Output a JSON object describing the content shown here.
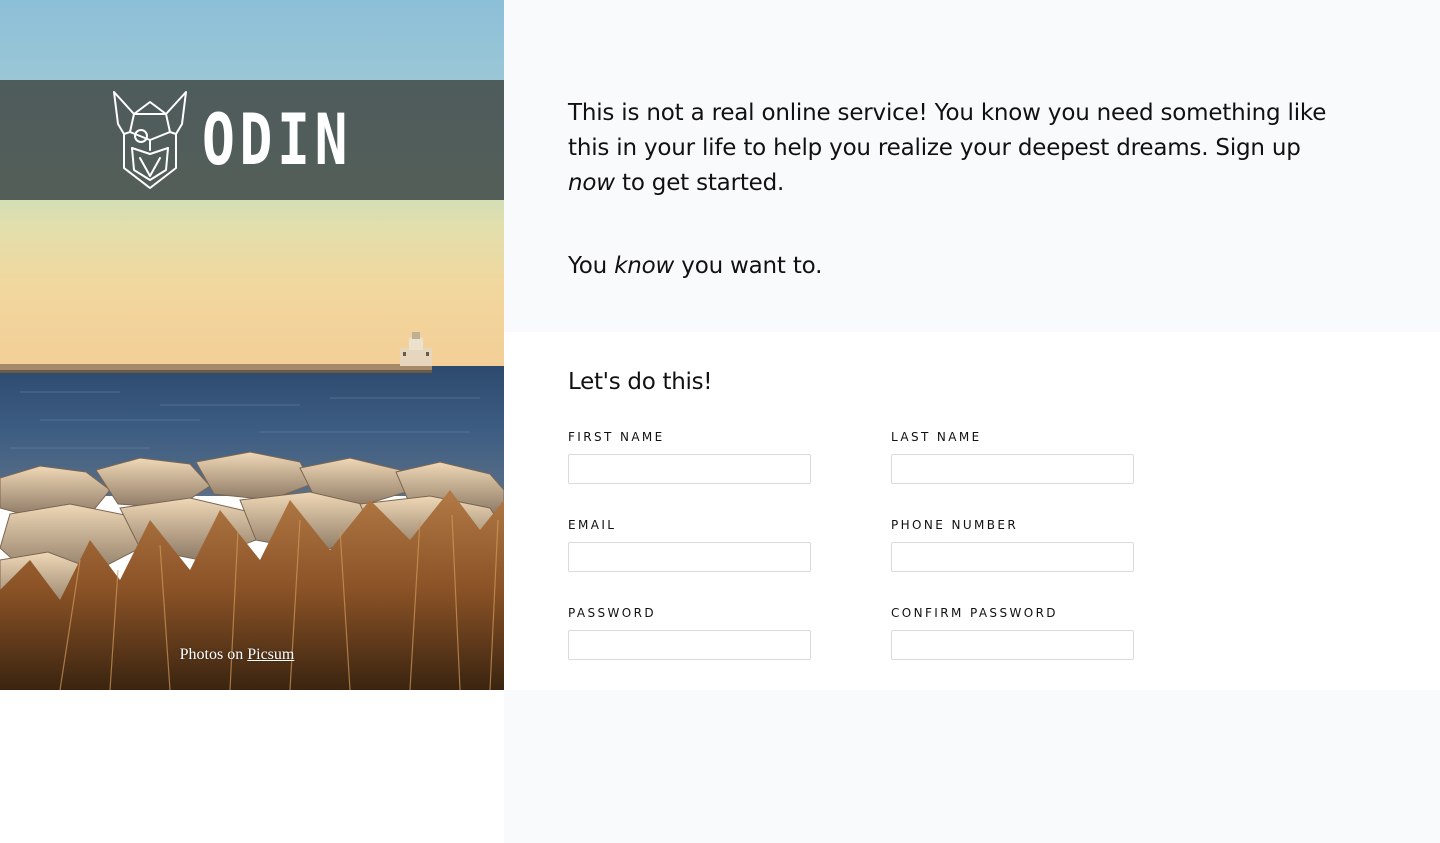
{
  "brand": {
    "name": "ODIN",
    "logo_icon": "viking-helmet-icon"
  },
  "photo_credit": {
    "prefix": "Photos on",
    "link_text": "Picsum"
  },
  "intro": {
    "paragraph1": {
      "before": "This is not a real online service! You know you need something like this in your life to help you realize your deepest dreams. Sign up",
      "emphasis": "now",
      "after": "to get started."
    },
    "paragraph2": {
      "before": "You",
      "emphasis": "know",
      "after": "you want to."
    }
  },
  "form": {
    "title": "Let's do this!",
    "fields": {
      "first_name": {
        "label": "FIRST NAME",
        "value": ""
      },
      "last_name": {
        "label": "LAST NAME",
        "value": ""
      },
      "email": {
        "label": "EMAIL",
        "value": ""
      },
      "phone_number": {
        "label": "PHONE NUMBER",
        "value": ""
      },
      "password": {
        "label": "PASSWORD",
        "value": ""
      },
      "confirm_password": {
        "label": "CONFIRM PASSWORD",
        "value": ""
      }
    }
  },
  "colors": {
    "logo_band": "#46504e",
    "right_background": "#f9fafb",
    "form_background": "#ffffff",
    "input_border": "#d9dcdf"
  }
}
